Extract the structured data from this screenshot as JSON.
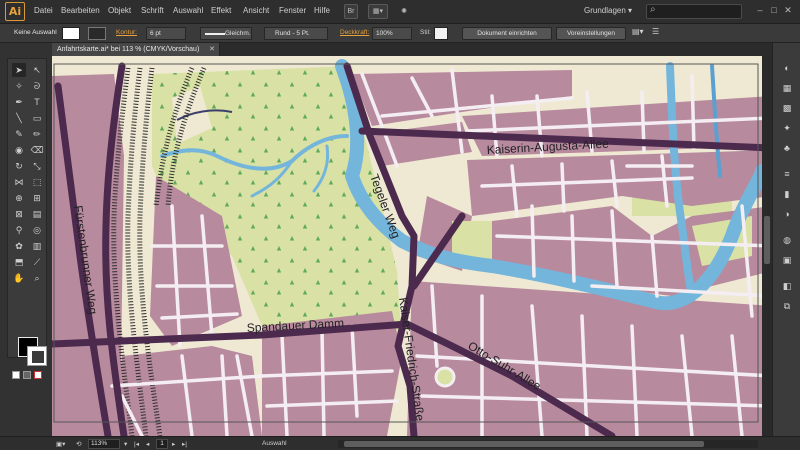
{
  "app": {
    "logo": "Ai",
    "menu": [
      "Datei",
      "Bearbeiten",
      "Objekt",
      "Schrift",
      "Auswahl",
      "Effekt",
      "Ansicht",
      "Fenster",
      "Hilfe"
    ],
    "bridge_button": "Br",
    "workspace": "Grundlagen",
    "workspace_arrow": "▾",
    "search_placeholder": "",
    "window_controls": [
      "–",
      "□",
      "✕"
    ]
  },
  "control_bar": {
    "selection_label": "Keine Auswahl",
    "kontur_label": "Kontur:",
    "kontur_value": "6 pt",
    "stroke_profile": "Gleichm.",
    "brush": "Rund - 5 Pt.",
    "deckkraft_label": "Deckkraft:",
    "deckkraft_value": "100%",
    "stil_label": "Stil:",
    "document_setup_button": "Dokument einrichten",
    "preferences_button": "Voreinstellungen"
  },
  "document_tab": {
    "title": "Anfahrtskarte.ai* bei 113 % (CMYK/Vorschau)",
    "close": "✕"
  },
  "statusbar": {
    "zoom": "113%",
    "page": "1",
    "tool": "Auswahl"
  },
  "map": {
    "street_labels": [
      "Kaiserin-Augusta-Allee",
      "Tegeler Weg",
      "Fürstenbrunner Weg",
      "Spandauer Damm",
      "Kaiser-Friedrich-Straße",
      "Otto-Suhr-Allee"
    ]
  },
  "colors": {
    "accent": "#e8a13c",
    "background_land": "#efe9d4",
    "park": "#d9e2a4",
    "residential": "#b88a9e",
    "road_main": "#4c2a4e",
    "road_minor": "#f4eef2",
    "river": "#74b5dc"
  }
}
